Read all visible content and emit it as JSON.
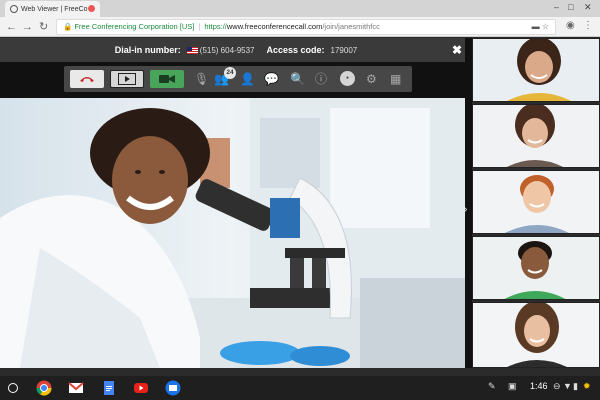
{
  "browser": {
    "tab_title": "Web Viewer | FreeCo",
    "url": {
      "org": "Free Conferencing Corporation [US]",
      "scheme": "https://",
      "host": "www.freeconferencecall.com",
      "path": "/join/janesmithfcc"
    }
  },
  "conference": {
    "dial_in_label": "Dial-in number:",
    "dial_in_value": "(515) 604-9537",
    "access_label": "Access code:",
    "access_value": "179007",
    "participant_count": "24"
  },
  "shelf": {
    "time": "1:46"
  },
  "colors": {
    "camera_active": "#49a55a",
    "hangup_red": "#c62828",
    "toolbar_dark": "#474747"
  }
}
